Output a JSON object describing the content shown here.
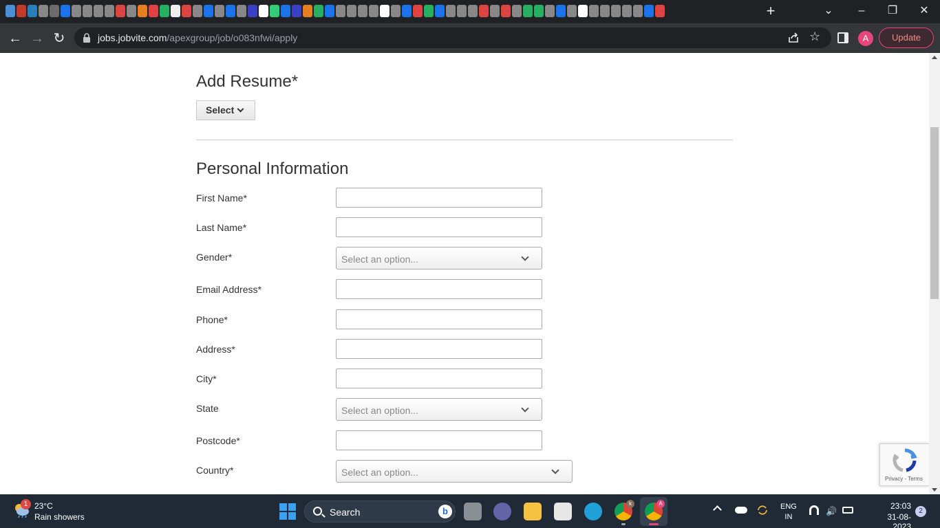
{
  "browser": {
    "url_host": "jobs.jobvite.com",
    "url_path": "/apexgroup/job/o083nfwi/apply",
    "avatar_letter": "A",
    "update_label": "Update",
    "new_tab_glyph": "+",
    "win_minimize": "–",
    "win_restore": "❐",
    "win_close": "✕",
    "tab_dropdown": "⌄",
    "back_glyph": "←",
    "forward_glyph": "→",
    "reload_glyph": "↻",
    "star_glyph": "☆",
    "favicon_colors": [
      "#4a90d9",
      "#c0392b",
      "#2980b9",
      "#888",
      "#6c6c6c",
      "#1a73e8",
      "#888",
      "#888",
      "#888",
      "#888",
      "#d44",
      "#888",
      "#e67e22",
      "#d44",
      "#27ae60",
      "#eee",
      "#d44",
      "#888",
      "#1a73e8",
      "#888",
      "#1a73e8",
      "#888",
      "#3c40c6",
      "#fff",
      "#3c7",
      "#1a73e8",
      "#3c40c6",
      "#e67e22",
      "#27ae60",
      "#1a73e8",
      "#888",
      "#888",
      "#888",
      "#888",
      "#fff",
      "#888",
      "#1a73e8",
      "#d44",
      "#27ae60",
      "#1a73e8",
      "#888",
      "#888",
      "#888",
      "#d44",
      "#888",
      "#d44",
      "#888",
      "#27ae60",
      "#27ae60",
      "#888",
      "#1a73e8",
      "#888",
      "#fff",
      "#888",
      "#888",
      "#888",
      "#888",
      "#888",
      "#1a73e8",
      "#d44"
    ]
  },
  "form": {
    "resume_title": "Add Resume*",
    "resume_select_label": "Select",
    "personal_title": "Personal Information",
    "select_placeholder": "Select an option...",
    "fields": {
      "first_name": "First Name*",
      "last_name": "Last Name*",
      "gender": "Gender*",
      "email": "Email Address*",
      "phone": "Phone*",
      "address": "Address*",
      "city": "City*",
      "state": "State",
      "postcode": "Postcode*",
      "country": "Country*"
    }
  },
  "recaptcha": {
    "links": "Privacy - Terms"
  },
  "taskbar": {
    "weather_badge": "1",
    "weather_temp": "23°C",
    "weather_desc": "Rain showers",
    "search_label": "Search",
    "bing_glyph": "b",
    "lang_line1": "ENG",
    "lang_line2": "IN",
    "volume_glyph": "🔊",
    "time": "23:03",
    "date": "31-08-2023",
    "notif_count": "2",
    "chrome_profile_badge": "k",
    "chrome_active_badge": "A"
  }
}
